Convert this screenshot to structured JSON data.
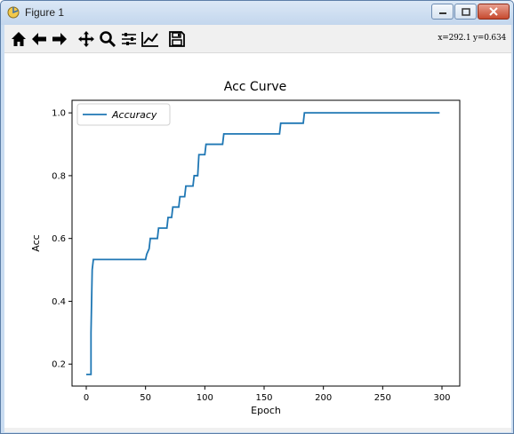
{
  "window": {
    "title": "Figure 1",
    "coords_readout": "x=292.1 y=0.634"
  },
  "toolbar": {
    "tools": [
      {
        "name": "home-icon"
      },
      {
        "name": "back-icon"
      },
      {
        "name": "forward-icon"
      },
      {
        "name": "pan-icon"
      },
      {
        "name": "zoom-icon"
      },
      {
        "name": "subplots-icon"
      },
      {
        "name": "customize-icon"
      },
      {
        "name": "save-icon"
      }
    ]
  },
  "chart_data": {
    "type": "line",
    "title": "Acc Curve",
    "xlabel": "Epoch",
    "ylabel": "Acc",
    "xlim": [
      -12,
      315
    ],
    "ylim": [
      0.13,
      1.04
    ],
    "xticks": [
      0,
      50,
      100,
      150,
      200,
      250,
      300
    ],
    "yticks": [
      0.2,
      0.4,
      0.6,
      0.8,
      1.0
    ],
    "ytick_labels": [
      "0.2",
      "0.4",
      "0.6",
      "0.8",
      "1.0"
    ],
    "legend": {
      "location": "upper-left",
      "entries": [
        "Accuracy"
      ]
    },
    "grid": false,
    "colors": {
      "line": "#1f77b4"
    },
    "series": [
      {
        "name": "Accuracy",
        "x": [
          0,
          4,
          4,
          5,
          6,
          50,
          51,
          53,
          54,
          60,
          61,
          68,
          69,
          72,
          73,
          78,
          79,
          83,
          84,
          90,
          91,
          94,
          95,
          100,
          101,
          107,
          108,
          115,
          116,
          163,
          164,
          183,
          184,
          298
        ],
        "y": [
          0.167,
          0.167,
          0.3,
          0.5,
          0.533,
          0.533,
          0.55,
          0.567,
          0.6,
          0.6,
          0.633,
          0.633,
          0.667,
          0.667,
          0.7,
          0.7,
          0.733,
          0.733,
          0.767,
          0.767,
          0.8,
          0.8,
          0.867,
          0.867,
          0.9,
          0.9,
          0.9,
          0.9,
          0.933,
          0.933,
          0.967,
          0.967,
          1.0,
          1.0
        ]
      }
    ]
  }
}
